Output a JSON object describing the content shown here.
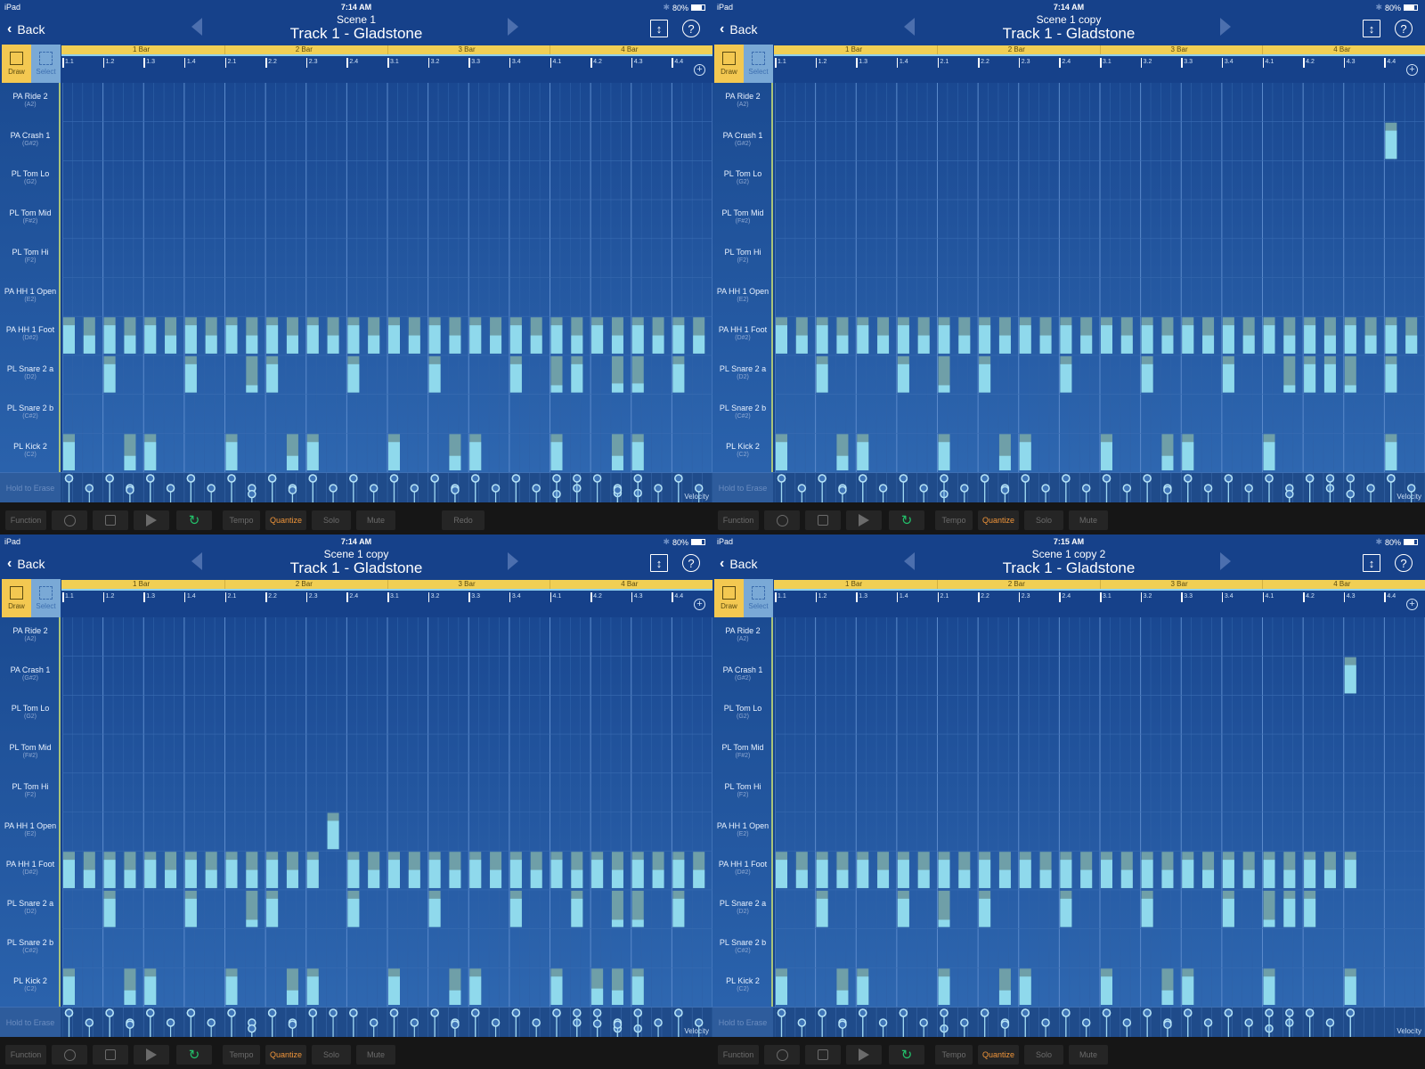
{
  "status": {
    "device": "iPad",
    "battery_label": "80%",
    "battery_level": 0.8
  },
  "common": {
    "back_label": "Back",
    "track_title": "Track 1 - Gladstone",
    "draw_label": "Draw",
    "select_label": "Select",
    "erase_label": "Hold to Erase",
    "velocity_label": "Velocity",
    "bars": [
      "1 Bar",
      "2 Bar",
      "3 Bar",
      "4 Bar"
    ],
    "ticks": [
      "1.1",
      "1.2",
      "1.3",
      "1.4",
      "2.1",
      "2.2",
      "2.3",
      "2.4",
      "3.1",
      "3.2",
      "3.3",
      "3.4",
      "4.1",
      "4.2",
      "4.3",
      "4.4"
    ],
    "rows": [
      {
        "name": "PA Ride 2",
        "note": "(A2)"
      },
      {
        "name": "PA Crash 1",
        "note": "(G#2)"
      },
      {
        "name": "PL Tom Lo",
        "note": "(G2)"
      },
      {
        "name": "PL Tom Mid",
        "note": "(F#2)"
      },
      {
        "name": "PL Tom Hi",
        "note": "(F2)"
      },
      {
        "name": "PA HH 1 Open",
        "note": "(E2)"
      },
      {
        "name": "PA HH 1 Foot",
        "note": "(D#2)"
      },
      {
        "name": "PL Snare 2 a",
        "note": "(D2)"
      },
      {
        "name": "PL Snare 2 b",
        "note": "(C#2)"
      },
      {
        "name": "PL Kick 2",
        "note": "(C2)"
      }
    ],
    "transport": {
      "function": "Function",
      "tempo": "Tempo",
      "quantize": "Quantize",
      "solo": "Solo",
      "mute": "Mute",
      "redo": "Redo"
    },
    "colors": {
      "note_fill": "#8fd9ec",
      "note_top": "#6f9fa8",
      "accent": "#f1cf54",
      "quantize": "#f0953a",
      "loop": "#23c06a"
    }
  },
  "panels": [
    {
      "time": "7:14 AM",
      "scene": "Scene  1",
      "show_redo": true,
      "notes": {
        "hh_foot": [
          [
            0,
            1
          ],
          [
            1,
            0.5
          ],
          [
            2,
            1
          ],
          [
            3,
            0.5
          ],
          [
            4,
            1
          ],
          [
            5,
            0.5
          ],
          [
            6,
            1
          ],
          [
            7,
            0.5
          ],
          [
            8,
            1
          ],
          [
            9,
            0.5
          ],
          [
            10,
            1
          ],
          [
            11,
            0.5
          ],
          [
            12,
            1
          ],
          [
            13,
            0.5
          ],
          [
            14,
            1
          ],
          [
            15,
            0.5
          ],
          [
            16,
            1
          ],
          [
            17,
            0.5
          ],
          [
            18,
            1
          ],
          [
            19,
            0.5
          ],
          [
            20,
            1
          ],
          [
            21,
            0.5
          ],
          [
            22,
            1
          ],
          [
            23,
            0.5
          ],
          [
            24,
            1
          ],
          [
            25,
            0.5
          ],
          [
            26,
            1
          ],
          [
            27,
            0.5
          ],
          [
            28,
            1
          ],
          [
            29,
            0.5
          ],
          [
            30,
            1
          ],
          [
            31,
            0.5
          ]
        ],
        "snare_a": [
          [
            2,
            1
          ],
          [
            6,
            1
          ],
          [
            9,
            0.2
          ],
          [
            10,
            1
          ],
          [
            14,
            1
          ],
          [
            18,
            1
          ],
          [
            22,
            1
          ],
          [
            24,
            0.2
          ],
          [
            25,
            1
          ],
          [
            27,
            0.25
          ],
          [
            28,
            0.25
          ],
          [
            30,
            1
          ]
        ],
        "kick": [
          [
            0,
            1
          ],
          [
            3,
            0.4
          ],
          [
            4,
            1
          ],
          [
            8,
            1
          ],
          [
            11,
            0.4
          ],
          [
            12,
            1
          ],
          [
            16,
            1
          ],
          [
            19,
            0.4
          ],
          [
            20,
            1
          ],
          [
            24,
            1
          ],
          [
            27,
            0.4
          ],
          [
            28,
            1
          ]
        ],
        "crash": [],
        "hh_open": []
      }
    },
    {
      "time": "7:14 AM",
      "scene": "Scene  1 copy",
      "show_redo": false,
      "notes": {
        "hh_foot": [
          [
            0,
            1
          ],
          [
            1,
            0.5
          ],
          [
            2,
            1
          ],
          [
            3,
            0.5
          ],
          [
            4,
            1
          ],
          [
            5,
            0.5
          ],
          [
            6,
            1
          ],
          [
            7,
            0.5
          ],
          [
            8,
            1
          ],
          [
            9,
            0.5
          ],
          [
            10,
            1
          ],
          [
            11,
            0.5
          ],
          [
            12,
            1
          ],
          [
            13,
            0.5
          ],
          [
            14,
            1
          ],
          [
            15,
            0.5
          ],
          [
            16,
            1
          ],
          [
            17,
            0.5
          ],
          [
            18,
            1
          ],
          [
            19,
            0.5
          ],
          [
            20,
            1
          ],
          [
            21,
            0.5
          ],
          [
            22,
            1
          ],
          [
            23,
            0.5
          ],
          [
            24,
            1
          ],
          [
            25,
            0.5
          ],
          [
            26,
            1
          ],
          [
            27,
            0.5
          ],
          [
            28,
            1
          ],
          [
            29,
            0.5
          ],
          [
            30,
            1
          ],
          [
            31,
            0.5
          ]
        ],
        "snare_a": [
          [
            2,
            1
          ],
          [
            6,
            1
          ],
          [
            8,
            0.2
          ],
          [
            10,
            1
          ],
          [
            14,
            1
          ],
          [
            18,
            1
          ],
          [
            22,
            1
          ],
          [
            25,
            0.2
          ],
          [
            26,
            1
          ],
          [
            27,
            1
          ],
          [
            28,
            0.2
          ],
          [
            30,
            1
          ]
        ],
        "kick": [
          [
            0,
            1
          ],
          [
            3,
            0.4
          ],
          [
            4,
            1
          ],
          [
            8,
            1
          ],
          [
            11,
            0.4
          ],
          [
            12,
            1
          ],
          [
            16,
            1
          ],
          [
            19,
            0.4
          ],
          [
            20,
            1
          ],
          [
            24,
            1
          ],
          [
            30,
            1
          ]
        ],
        "crash": [
          [
            30,
            1
          ]
        ],
        "hh_open": []
      }
    },
    {
      "time": "7:14 AM",
      "scene": "Scene  1 copy",
      "show_redo": false,
      "notes": {
        "hh_foot": [
          [
            0,
            1
          ],
          [
            1,
            0.5
          ],
          [
            2,
            1
          ],
          [
            3,
            0.5
          ],
          [
            4,
            1
          ],
          [
            5,
            0.5
          ],
          [
            6,
            1
          ],
          [
            7,
            0.5
          ],
          [
            8,
            1
          ],
          [
            9,
            0.5
          ],
          [
            10,
            1
          ],
          [
            11,
            0.5
          ],
          [
            12,
            1
          ],
          [
            14,
            1
          ],
          [
            15,
            0.5
          ],
          [
            16,
            1
          ],
          [
            17,
            0.5
          ],
          [
            18,
            1
          ],
          [
            19,
            0.5
          ],
          [
            20,
            1
          ],
          [
            21,
            0.5
          ],
          [
            22,
            1
          ],
          [
            23,
            0.5
          ],
          [
            24,
            1
          ],
          [
            25,
            0.5
          ],
          [
            26,
            1
          ],
          [
            27,
            0.5
          ],
          [
            28,
            1
          ],
          [
            29,
            0.5
          ],
          [
            30,
            1
          ],
          [
            31,
            0.5
          ]
        ],
        "snare_a": [
          [
            2,
            1
          ],
          [
            6,
            1
          ],
          [
            9,
            0.2
          ],
          [
            10,
            1
          ],
          [
            14,
            1
          ],
          [
            18,
            1
          ],
          [
            22,
            1
          ],
          [
            25,
            1
          ],
          [
            27,
            0.2
          ],
          [
            28,
            0.2
          ],
          [
            30,
            1
          ]
        ],
        "kick": [
          [
            0,
            1
          ],
          [
            3,
            0.4
          ],
          [
            4,
            1
          ],
          [
            8,
            1
          ],
          [
            11,
            0.4
          ],
          [
            12,
            1
          ],
          [
            16,
            1
          ],
          [
            19,
            0.4
          ],
          [
            20,
            1
          ],
          [
            24,
            1
          ],
          [
            26,
            0.45
          ],
          [
            27,
            0.4
          ],
          [
            28,
            1
          ]
        ],
        "crash": [],
        "hh_open": [
          [
            13,
            1
          ]
        ]
      }
    },
    {
      "time": "7:15 AM",
      "scene": "Scene  1 copy 2",
      "show_redo": false,
      "notes": {
        "hh_foot": [
          [
            0,
            1
          ],
          [
            1,
            0.5
          ],
          [
            2,
            1
          ],
          [
            3,
            0.5
          ],
          [
            4,
            1
          ],
          [
            5,
            0.5
          ],
          [
            6,
            1
          ],
          [
            7,
            0.5
          ],
          [
            8,
            1
          ],
          [
            9,
            0.5
          ],
          [
            10,
            1
          ],
          [
            11,
            0.5
          ],
          [
            12,
            1
          ],
          [
            13,
            0.5
          ],
          [
            14,
            1
          ],
          [
            15,
            0.5
          ],
          [
            16,
            1
          ],
          [
            17,
            0.5
          ],
          [
            18,
            1
          ],
          [
            19,
            0.5
          ],
          [
            20,
            1
          ],
          [
            21,
            0.5
          ],
          [
            22,
            1
          ],
          [
            23,
            0.5
          ],
          [
            24,
            1
          ],
          [
            25,
            0.5
          ],
          [
            26,
            1
          ],
          [
            27,
            0.5
          ],
          [
            28,
            1
          ]
        ],
        "snare_a": [
          [
            2,
            1
          ],
          [
            6,
            1
          ],
          [
            8,
            0.2
          ],
          [
            10,
            1
          ],
          [
            14,
            1
          ],
          [
            18,
            1
          ],
          [
            22,
            1
          ],
          [
            24,
            0.2
          ],
          [
            25,
            1
          ],
          [
            26,
            1
          ]
        ],
        "kick": [
          [
            0,
            1
          ],
          [
            3,
            0.4
          ],
          [
            4,
            1
          ],
          [
            8,
            1
          ],
          [
            11,
            0.4
          ],
          [
            12,
            1
          ],
          [
            16,
            1
          ],
          [
            19,
            0.4
          ],
          [
            20,
            1
          ],
          [
            24,
            1
          ],
          [
            28,
            1
          ]
        ],
        "crash": [
          [
            28,
            1
          ]
        ],
        "hh_open": []
      }
    }
  ]
}
